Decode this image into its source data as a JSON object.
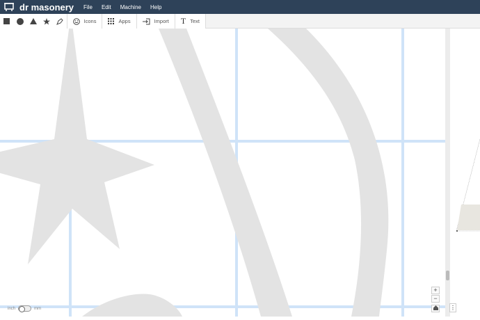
{
  "app": {
    "title": "dr masonery",
    "menus": [
      "File",
      "Edit",
      "Machine",
      "Help"
    ]
  },
  "toolbar": {
    "icons_label": "Icons",
    "apps_label": "Apps",
    "import_label": "Import",
    "text_label": "Text"
  },
  "units": {
    "left": "inch",
    "right": "mm"
  },
  "zoom": {
    "in": "+",
    "out": "−"
  },
  "colors": {
    "topbar": "#2e4259",
    "grid": "#cfe3f8",
    "shape": "#e3e3e3"
  }
}
